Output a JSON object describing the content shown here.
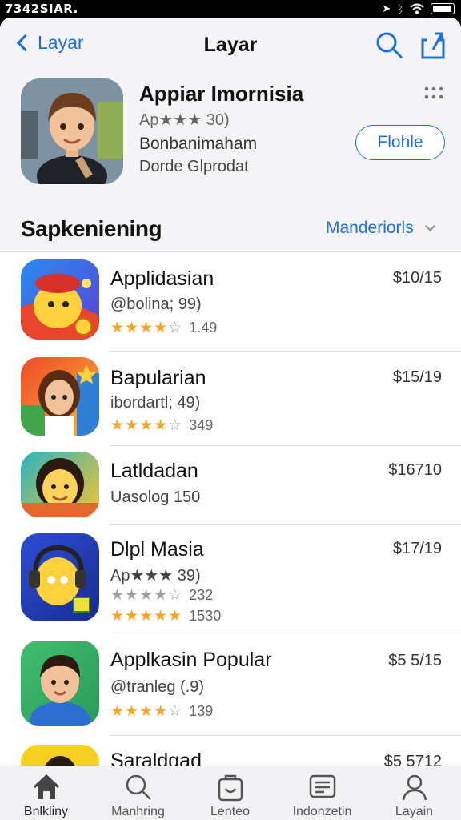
{
  "status_bar": {
    "time": "7342SIAR.",
    "icons": [
      "location-icon",
      "bluetooth-icon",
      "wifi-icon",
      "battery-icon"
    ]
  },
  "nav": {
    "back_label": "Layar",
    "title": "Layar"
  },
  "featured": {
    "title": "Appiar Imornisia",
    "rating_text": "Ap★★★ 30)",
    "developer": "Bonbanimaham",
    "category": "Dorde Glprodat",
    "get_label": "Flohle"
  },
  "section": {
    "title": "Sapkeniening",
    "link": "Manderiorls"
  },
  "apps": [
    {
      "name": "Applidasian",
      "sub": "@bolina; 99)",
      "price": "$10/15",
      "stars": "★★★★",
      "stars_grey": "☆",
      "count": "1.49"
    },
    {
      "name": "Bapularian",
      "sub": "ibordartl; 49)",
      "price": "$15/19",
      "stars": "★★★★",
      "stars_grey": "☆",
      "count": "349"
    },
    {
      "name": "Latldadan",
      "sub": "Uasolog 150",
      "price": "$16710",
      "stars": "",
      "stars_grey": "",
      "count": ""
    },
    {
      "name": "Dlpl Masia",
      "sub": "Ap★★★ 39)",
      "price": "$17/19",
      "stars": "★★★★",
      "stars_grey": "☆",
      "count": "232",
      "extra_stars": "★★★★★",
      "extra_count": "1530"
    },
    {
      "name": "Applkasin Popular",
      "sub": "@tranleg (.9)",
      "price": "$5 5/15",
      "stars": "★★★★",
      "stars_grey": "☆",
      "count": "139"
    },
    {
      "name": "Saraldgad",
      "sub": "",
      "price": "$5 5712",
      "stars": "",
      "stars_grey": "",
      "count": ""
    }
  ],
  "tabs": [
    {
      "label": "Bnlkliny",
      "icon": "home-icon"
    },
    {
      "label": "Manhring",
      "icon": "search-icon"
    },
    {
      "label": "Lenteo",
      "icon": "apps-icon"
    },
    {
      "label": "Indonzetin",
      "icon": "news-icon"
    },
    {
      "label": "Layain",
      "icon": "profile-icon"
    }
  ],
  "colors": {
    "accent": "#1e6fd9",
    "star": "#f5a623",
    "tabbar_bg": "#f2f2f4"
  }
}
